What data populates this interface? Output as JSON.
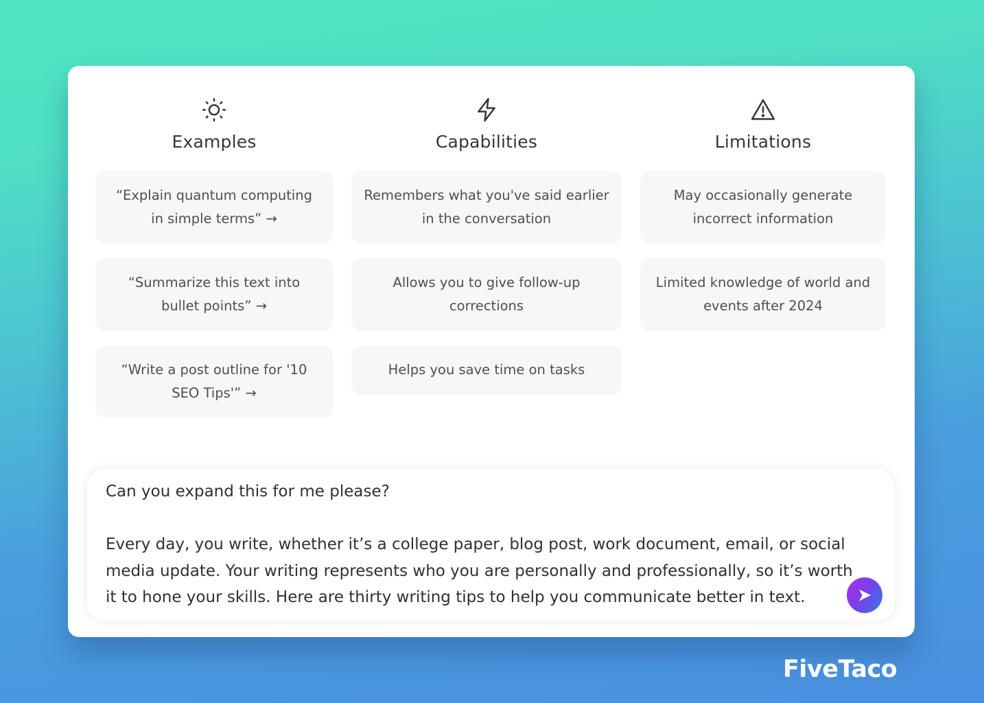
{
  "columns": [
    {
      "id": "examples",
      "icon": "sun-icon",
      "title": "Examples",
      "items": [
        "“Explain quantum computing in simple terms” →",
        "“Summarize this text into bullet points” →",
        "“Write a post outline for '10 SEO Tips'” →"
      ]
    },
    {
      "id": "capabilities",
      "icon": "lightning-icon",
      "title": "Capabilities",
      "items": [
        "Remembers what you've said earlier in the conversation",
        "Allows you to give follow-up corrections",
        "Helps you save time on tasks"
      ]
    },
    {
      "id": "limitations",
      "icon": "warning-icon",
      "title": "Limitations",
      "items": [
        "May occasionally generate incorrect information",
        "Limited knowledge of world and events after 2024"
      ]
    }
  ],
  "prompt": {
    "value": "Can you expand this for me please?\n\nEvery day, you write, whether it’s a college paper, blog post, work document, email, or social media update. Your writing represents who you are personally and professionally, so it’s worth it to hone your skills. Here are thirty writing tips to help you communicate better in text.",
    "send_icon": "send-icon"
  },
  "brand": {
    "name": "FiveTaco"
  },
  "colors": {
    "accent_start": "#b22ee8",
    "accent_end": "#2f7bea",
    "tile_bg": "#f7f7f8",
    "bg_top": "#50e3c2",
    "bg_bottom": "#4a8fe0"
  }
}
